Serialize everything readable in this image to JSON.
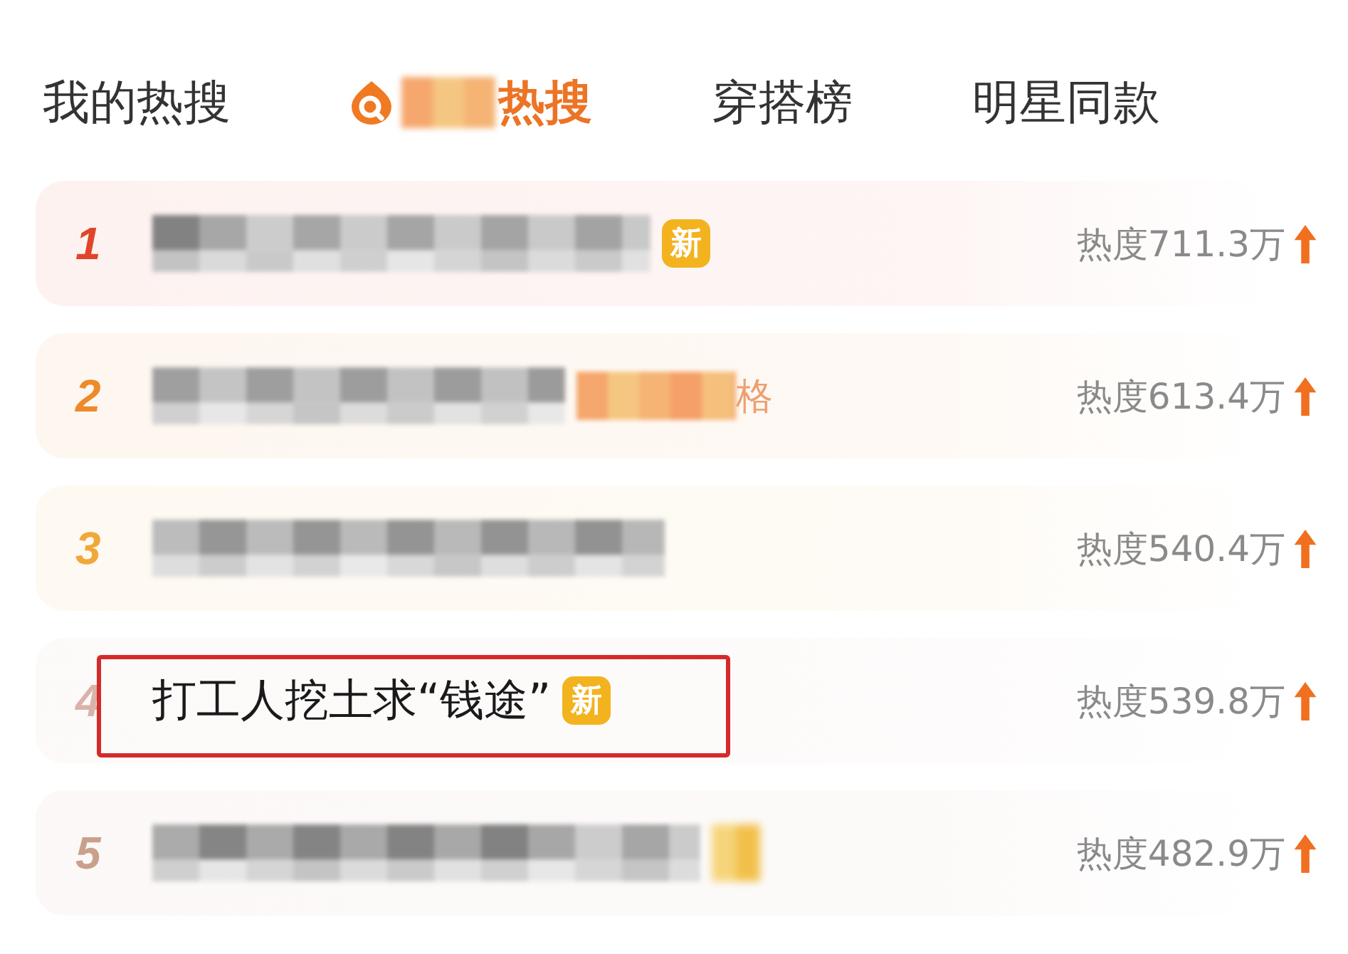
{
  "tabs": [
    {
      "label": "我的热搜",
      "selected": false,
      "kind": "plain"
    },
    {
      "label": "热搜",
      "selected": true,
      "kind": "brand"
    },
    {
      "label": "穿搭榜",
      "selected": false,
      "kind": "plain"
    },
    {
      "label": "明星同款",
      "selected": false,
      "kind": "plain"
    }
  ],
  "rows": [
    {
      "rank": "1",
      "color": "#e0452a",
      "kind": "pixelated",
      "badge": {
        "kind": "text",
        "label": "新"
      },
      "heat": "热度711.3万",
      "rising": true,
      "highlighted": false
    },
    {
      "rank": "2",
      "color": "#ee8a2a",
      "kind": "pixelated",
      "tag": {
        "kind": "pixelated-end",
        "label": "格"
      },
      "heat": "热度613.4万",
      "rising": true,
      "highlighted": false
    },
    {
      "rank": "3",
      "color": "#f0a83a",
      "kind": "pixelated",
      "heat": "热度540.4万",
      "rising": true,
      "highlighted": false
    },
    {
      "rank": "4",
      "color": "#dbb2aa",
      "kind": "text",
      "title": "打工人挖土求“钱途”",
      "badge": {
        "kind": "text",
        "label": "新"
      },
      "heat": "热度539.8万",
      "rising": true,
      "highlighted": true
    },
    {
      "rank": "5",
      "color": "#c9a08c",
      "kind": "pixelated",
      "badge": {
        "kind": "pixelated"
      },
      "heat": "热度482.9万",
      "rising": true,
      "highlighted": false
    }
  ]
}
